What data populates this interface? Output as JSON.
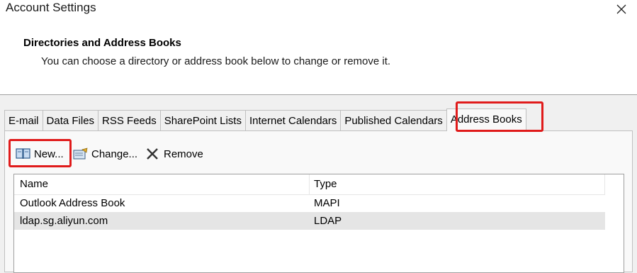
{
  "window": {
    "title": "Account Settings"
  },
  "header": {
    "title": "Directories and Address Books",
    "description": "You can choose a directory or address book below to change or remove it."
  },
  "tabs": [
    {
      "label": "E-mail"
    },
    {
      "label": "Data Files"
    },
    {
      "label": "RSS Feeds"
    },
    {
      "label": "SharePoint Lists"
    },
    {
      "label": "Internet Calendars"
    },
    {
      "label": "Published Calendars"
    },
    {
      "label": "Address Books",
      "active": true
    }
  ],
  "toolbar": {
    "new_label": "New...",
    "change_label": "Change...",
    "remove_label": "Remove"
  },
  "list": {
    "columns": [
      "Name",
      "Type"
    ],
    "rows": [
      {
        "name": "Outlook Address Book",
        "type": "MAPI"
      },
      {
        "name": "ldap.sg.aliyun.com",
        "type": "LDAP",
        "selected": true
      }
    ]
  },
  "colors": {
    "highlight": "#e01b1b",
    "selected_row": "#e5e5e5"
  }
}
